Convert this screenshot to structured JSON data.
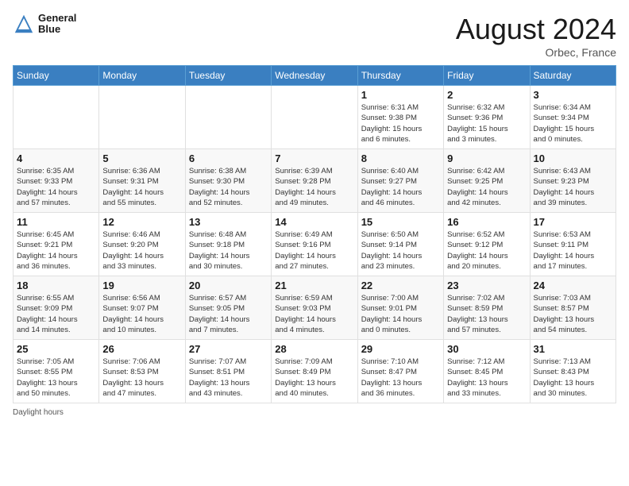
{
  "header": {
    "logo_line1": "General",
    "logo_line2": "Blue",
    "month_year": "August 2024",
    "location": "Orbec, France"
  },
  "days_of_week": [
    "Sunday",
    "Monday",
    "Tuesday",
    "Wednesday",
    "Thursday",
    "Friday",
    "Saturday"
  ],
  "weeks": [
    [
      {
        "day": "",
        "info": ""
      },
      {
        "day": "",
        "info": ""
      },
      {
        "day": "",
        "info": ""
      },
      {
        "day": "",
        "info": ""
      },
      {
        "day": "1",
        "info": "Sunrise: 6:31 AM\nSunset: 9:38 PM\nDaylight: 15 hours\nand 6 minutes."
      },
      {
        "day": "2",
        "info": "Sunrise: 6:32 AM\nSunset: 9:36 PM\nDaylight: 15 hours\nand 3 minutes."
      },
      {
        "day": "3",
        "info": "Sunrise: 6:34 AM\nSunset: 9:34 PM\nDaylight: 15 hours\nand 0 minutes."
      }
    ],
    [
      {
        "day": "4",
        "info": "Sunrise: 6:35 AM\nSunset: 9:33 PM\nDaylight: 14 hours\nand 57 minutes."
      },
      {
        "day": "5",
        "info": "Sunrise: 6:36 AM\nSunset: 9:31 PM\nDaylight: 14 hours\nand 55 minutes."
      },
      {
        "day": "6",
        "info": "Sunrise: 6:38 AM\nSunset: 9:30 PM\nDaylight: 14 hours\nand 52 minutes."
      },
      {
        "day": "7",
        "info": "Sunrise: 6:39 AM\nSunset: 9:28 PM\nDaylight: 14 hours\nand 49 minutes."
      },
      {
        "day": "8",
        "info": "Sunrise: 6:40 AM\nSunset: 9:27 PM\nDaylight: 14 hours\nand 46 minutes."
      },
      {
        "day": "9",
        "info": "Sunrise: 6:42 AM\nSunset: 9:25 PM\nDaylight: 14 hours\nand 42 minutes."
      },
      {
        "day": "10",
        "info": "Sunrise: 6:43 AM\nSunset: 9:23 PM\nDaylight: 14 hours\nand 39 minutes."
      }
    ],
    [
      {
        "day": "11",
        "info": "Sunrise: 6:45 AM\nSunset: 9:21 PM\nDaylight: 14 hours\nand 36 minutes."
      },
      {
        "day": "12",
        "info": "Sunrise: 6:46 AM\nSunset: 9:20 PM\nDaylight: 14 hours\nand 33 minutes."
      },
      {
        "day": "13",
        "info": "Sunrise: 6:48 AM\nSunset: 9:18 PM\nDaylight: 14 hours\nand 30 minutes."
      },
      {
        "day": "14",
        "info": "Sunrise: 6:49 AM\nSunset: 9:16 PM\nDaylight: 14 hours\nand 27 minutes."
      },
      {
        "day": "15",
        "info": "Sunrise: 6:50 AM\nSunset: 9:14 PM\nDaylight: 14 hours\nand 23 minutes."
      },
      {
        "day": "16",
        "info": "Sunrise: 6:52 AM\nSunset: 9:12 PM\nDaylight: 14 hours\nand 20 minutes."
      },
      {
        "day": "17",
        "info": "Sunrise: 6:53 AM\nSunset: 9:11 PM\nDaylight: 14 hours\nand 17 minutes."
      }
    ],
    [
      {
        "day": "18",
        "info": "Sunrise: 6:55 AM\nSunset: 9:09 PM\nDaylight: 14 hours\nand 14 minutes."
      },
      {
        "day": "19",
        "info": "Sunrise: 6:56 AM\nSunset: 9:07 PM\nDaylight: 14 hours\nand 10 minutes."
      },
      {
        "day": "20",
        "info": "Sunrise: 6:57 AM\nSunset: 9:05 PM\nDaylight: 14 hours\nand 7 minutes."
      },
      {
        "day": "21",
        "info": "Sunrise: 6:59 AM\nSunset: 9:03 PM\nDaylight: 14 hours\nand 4 minutes."
      },
      {
        "day": "22",
        "info": "Sunrise: 7:00 AM\nSunset: 9:01 PM\nDaylight: 14 hours\nand 0 minutes."
      },
      {
        "day": "23",
        "info": "Sunrise: 7:02 AM\nSunset: 8:59 PM\nDaylight: 13 hours\nand 57 minutes."
      },
      {
        "day": "24",
        "info": "Sunrise: 7:03 AM\nSunset: 8:57 PM\nDaylight: 13 hours\nand 54 minutes."
      }
    ],
    [
      {
        "day": "25",
        "info": "Sunrise: 7:05 AM\nSunset: 8:55 PM\nDaylight: 13 hours\nand 50 minutes."
      },
      {
        "day": "26",
        "info": "Sunrise: 7:06 AM\nSunset: 8:53 PM\nDaylight: 13 hours\nand 47 minutes."
      },
      {
        "day": "27",
        "info": "Sunrise: 7:07 AM\nSunset: 8:51 PM\nDaylight: 13 hours\nand 43 minutes."
      },
      {
        "day": "28",
        "info": "Sunrise: 7:09 AM\nSunset: 8:49 PM\nDaylight: 13 hours\nand 40 minutes."
      },
      {
        "day": "29",
        "info": "Sunrise: 7:10 AM\nSunset: 8:47 PM\nDaylight: 13 hours\nand 36 minutes."
      },
      {
        "day": "30",
        "info": "Sunrise: 7:12 AM\nSunset: 8:45 PM\nDaylight: 13 hours\nand 33 minutes."
      },
      {
        "day": "31",
        "info": "Sunrise: 7:13 AM\nSunset: 8:43 PM\nDaylight: 13 hours\nand 30 minutes."
      }
    ]
  ],
  "footer": {
    "daylight_label": "Daylight hours"
  }
}
